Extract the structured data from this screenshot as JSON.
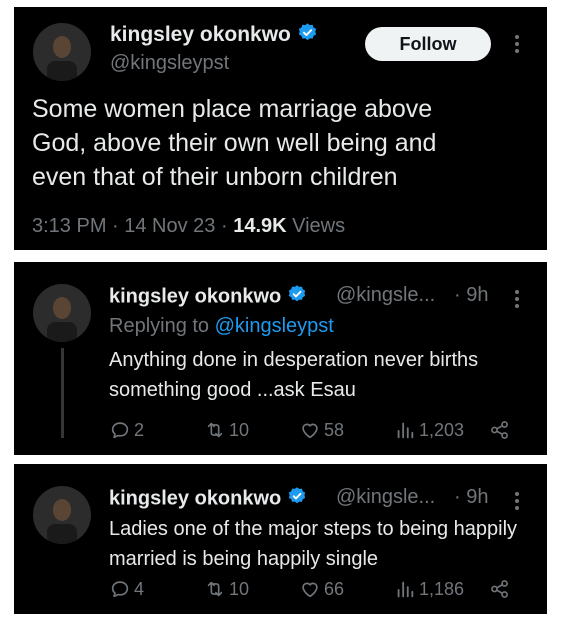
{
  "main_tweet": {
    "author_name": "kingsley okonkwo",
    "handle": "@kingsleypst",
    "follow_label": "Follow",
    "text": "Some women place marriage above God, above their own well being and even that of their unborn children",
    "time": "3:13 PM · 14 Nov 23 · ",
    "views_count": "14.9K",
    "views_label": " Views"
  },
  "reply1": {
    "author_name": "kingsley okonkwo",
    "handle": "@kingsle...",
    "time": "· 9h",
    "replying_prefix": "Replying to ",
    "replying_to": "@kingsleypst",
    "text": "Anything done in desperation never births something good ...ask Esau",
    "replies": "2",
    "reposts": "10",
    "likes": "58",
    "views": "1,203"
  },
  "reply2": {
    "author_name": "kingsley okonkwo",
    "handle": "@kingsle...",
    "time": "· 9h",
    "text": "Ladies one of the major steps to being happily married is being happily single",
    "replies": "4",
    "reposts": "10",
    "likes": "66",
    "views": "1,186"
  },
  "colors": {
    "background": "#000000",
    "text": "#e7e9ea",
    "muted": "#71767b",
    "link": "#1d9bf0",
    "verified": "#1d9bf0"
  },
  "icons": [
    "verified-icon",
    "more-icon",
    "reply-icon",
    "repost-icon",
    "like-icon",
    "views-icon",
    "share-icon"
  ]
}
